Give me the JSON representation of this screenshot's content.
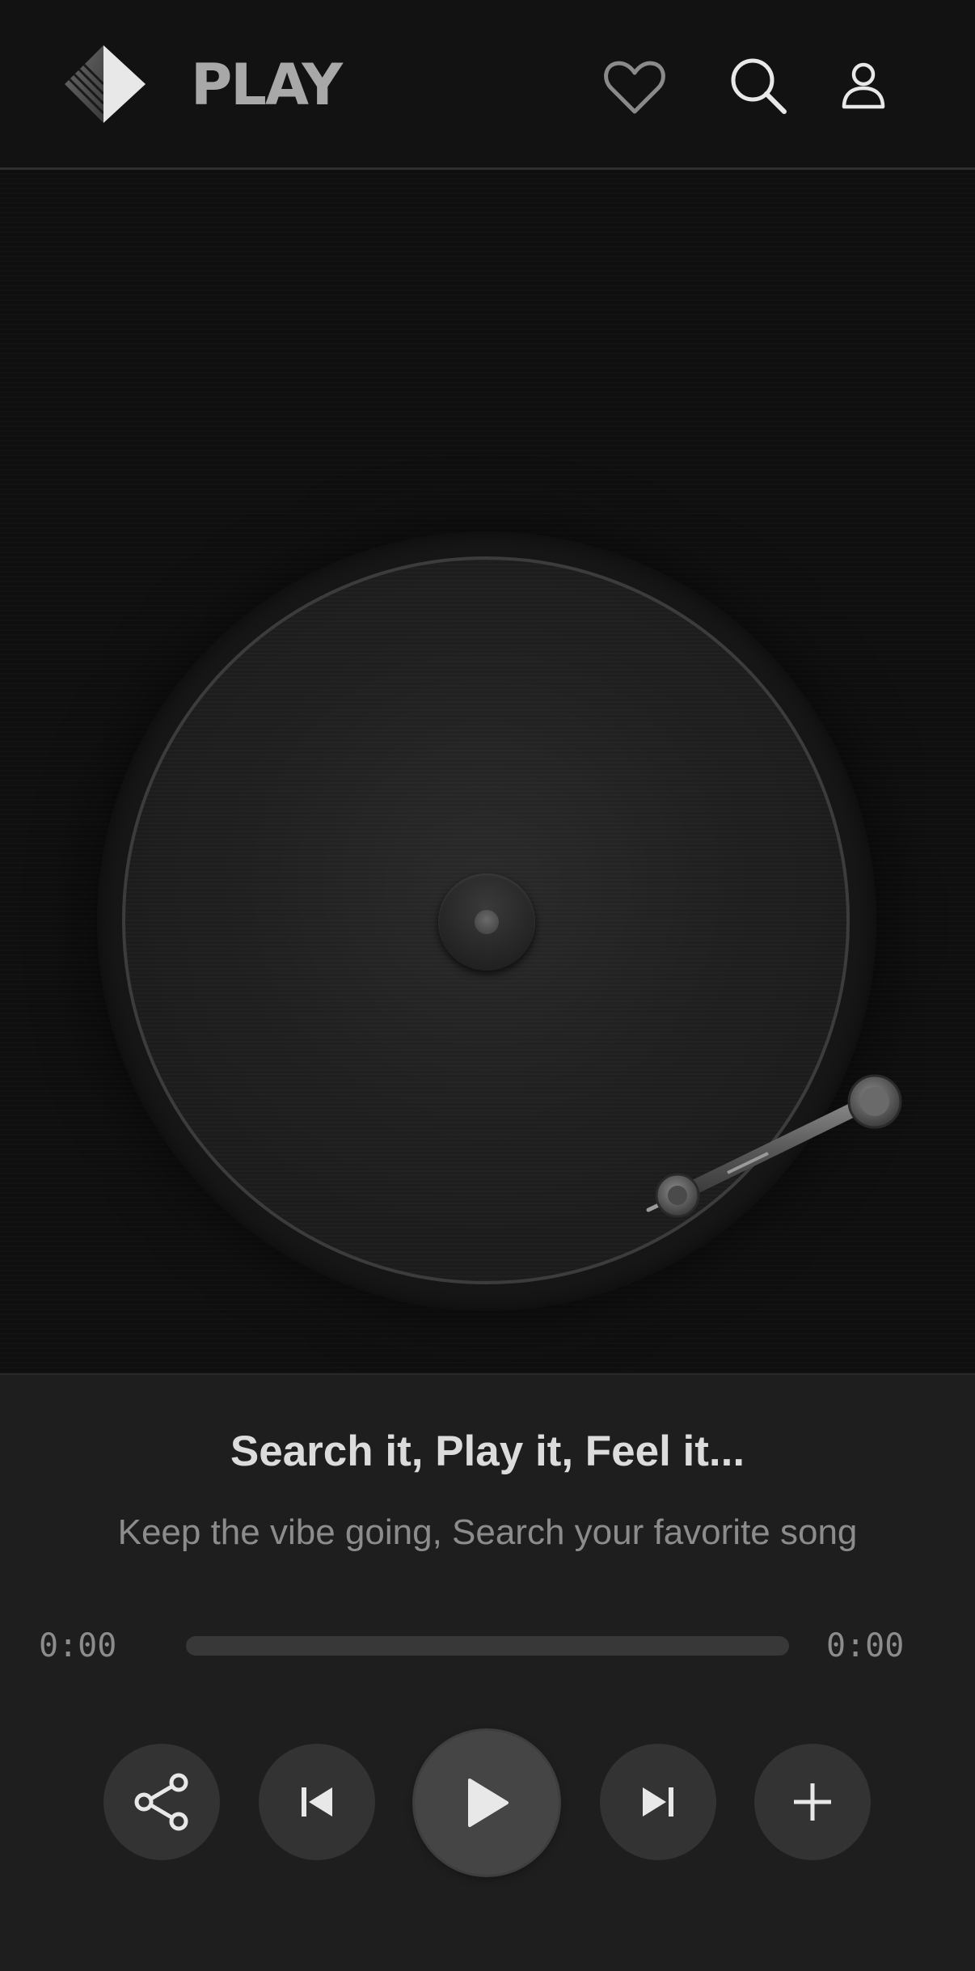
{
  "app": {
    "brand": "PLAY"
  },
  "header": {
    "icons": [
      "diamond-logo-icon",
      "heart-icon",
      "search-icon",
      "user-icon"
    ]
  },
  "player": {
    "title": "Search it, Play it, Feel it...",
    "subtitle": "Keep the vibe going, Search your favorite song",
    "current_time": "0:00",
    "total_time": "0:00",
    "progress": 0
  },
  "controls": {
    "icons": [
      "share-icon",
      "skip-previous-icon",
      "play-icon",
      "skip-next-icon",
      "plus-icon"
    ]
  },
  "colors": {
    "header_bg": "#121212",
    "panel_bg": "#1e1e1e",
    "button_bg": "#333333",
    "title_text": "#dcdcdc",
    "muted_text": "#8c8c8c"
  }
}
